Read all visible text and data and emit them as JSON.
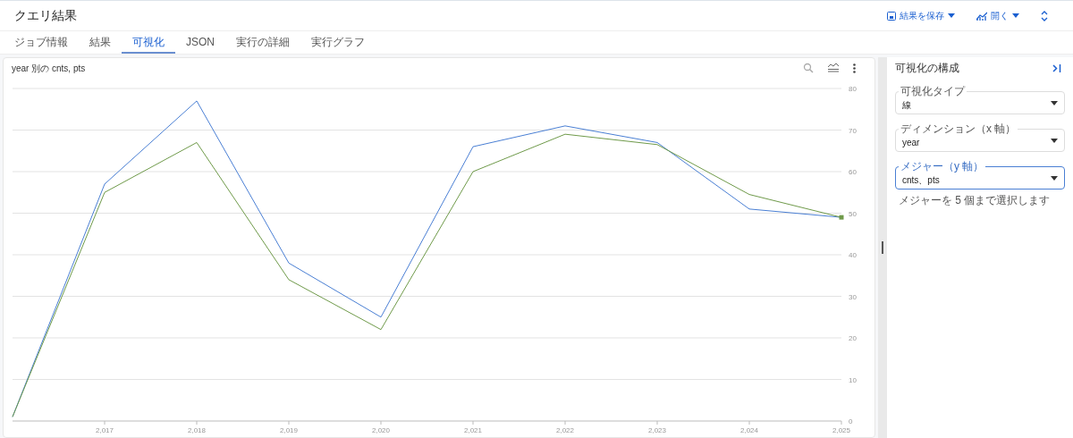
{
  "header": {
    "title": "クエリ結果",
    "actions": [
      {
        "kind": "save",
        "label": "結果を保存"
      },
      {
        "kind": "open",
        "label": "開く"
      }
    ]
  },
  "tabs": [
    {
      "label": "ジョブ情報",
      "selected": false
    },
    {
      "label": "結果",
      "selected": false
    },
    {
      "label": "可視化",
      "selected": true
    },
    {
      "label": "JSON",
      "selected": false
    },
    {
      "label": "実行の詳細",
      "selected": false
    },
    {
      "label": "実行グラフ",
      "selected": false
    }
  ],
  "chart_card": {
    "title": "year 別の cnts, pts",
    "chart_data": {
      "type": "line",
      "grid": true,
      "x": [
        2016,
        2017,
        2018,
        2019,
        2020,
        2021,
        2022,
        2023,
        2024,
        2025
      ],
      "xlim": [
        2016,
        2025
      ],
      "ylim": [
        0,
        80
      ],
      "xticks": [
        {
          "value": 2017,
          "label": "2,017"
        },
        {
          "value": 2018,
          "label": "2,018"
        },
        {
          "value": 2019,
          "label": "2,019"
        },
        {
          "value": 2020,
          "label": "2,020"
        },
        {
          "value": 2021,
          "label": "2,021"
        },
        {
          "value": 2022,
          "label": "2,022"
        },
        {
          "value": 2023,
          "label": "2,023"
        },
        {
          "value": 2024,
          "label": "2,024"
        },
        {
          "value": 2025,
          "label": "2,025"
        }
      ],
      "yticks": [
        0,
        10,
        20,
        30,
        40,
        50,
        60,
        70,
        80
      ],
      "series": [
        {
          "color": "#4a7fd4",
          "values": [
            1,
            57,
            77,
            38,
            25,
            66,
            71,
            67,
            51,
            49
          ]
        },
        {
          "color": "#6f9a4a",
          "values": [
            1,
            55,
            67,
            34,
            22,
            60,
            69,
            66.5,
            54.5,
            49
          ]
        }
      ]
    }
  },
  "config_panel": {
    "title": "可視化の構成",
    "fields": [
      {
        "label": "可視化タイプ",
        "value": "線",
        "focused": false
      },
      {
        "label": "ディメンション（x 軸）",
        "value": "year",
        "focused": false
      },
      {
        "label": "メジャー（y 軸）",
        "value": "cnts、pts",
        "focused": true,
        "helper": "メジャーを 5 個まで選択します"
      }
    ]
  }
}
